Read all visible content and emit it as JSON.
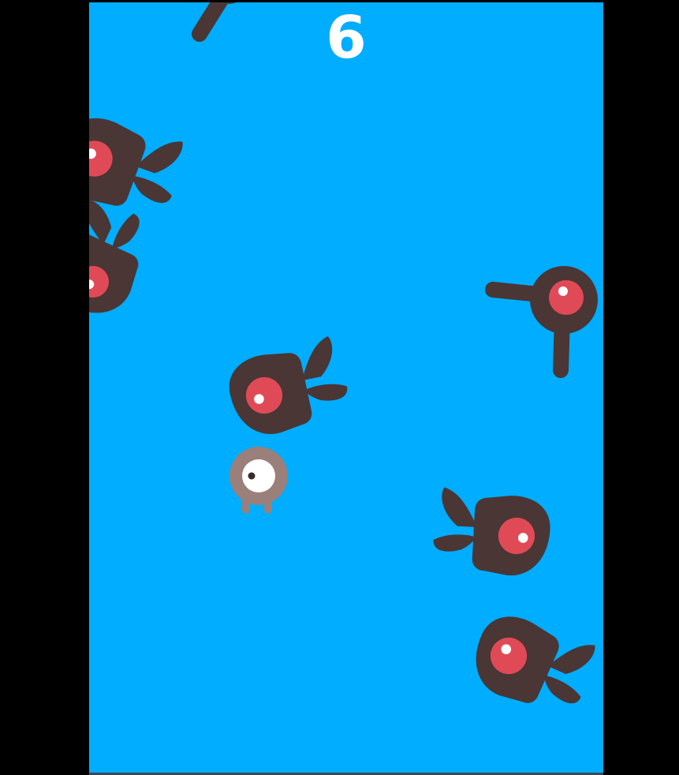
{
  "game": {
    "score": "6"
  },
  "colors": {
    "outer_background": "#000000",
    "playfield": "#00adff",
    "score_text": "#ffffff",
    "enemy_body": "#4a3635",
    "enemy_eye": "#e04a57",
    "enemy_eye_highlight": "#ffffff",
    "player_body": "#9a7f7a",
    "player_eye_white": "#ffffff",
    "player_pupil": "#3a2a2a",
    "bottom_edge": "#3b4a55"
  },
  "icons": {
    "player": "one-eyed-creature",
    "enemy_squid": "red-eyed-squid-enemy",
    "enemy_pole": "red-eyed-lollipop-enemy"
  }
}
